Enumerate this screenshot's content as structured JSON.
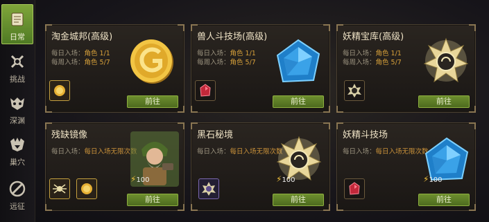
{
  "sidebar": {
    "items": [
      {
        "label": "日常",
        "icon": "scroll-icon",
        "active": true
      },
      {
        "label": "挑战",
        "icon": "crossed-swords-icon",
        "active": false
      },
      {
        "label": "深渊",
        "icon": "demon-mask-icon",
        "active": false
      },
      {
        "label": "巢穴",
        "icon": "dragon-lair-icon",
        "active": false
      },
      {
        "label": "远征",
        "icon": "expedition-icon",
        "active": false
      }
    ]
  },
  "cards": [
    {
      "title": "淘金城邦(高级)",
      "daily_label": "每日入场：",
      "daily_value": "角色 1/1",
      "weekly_label": "每周入场：",
      "weekly_value": "角色 5/7",
      "button": "前往",
      "art": "gold-coin-icon",
      "rewards": [
        "coin-icon"
      ]
    },
    {
      "title": "兽人斗技场(高级)",
      "daily_label": "每日入场：",
      "daily_value": "角色 1/1",
      "weekly_label": "每周入场：",
      "weekly_value": "角色 5/7",
      "button": "前往",
      "art": "blue-crystal-icon",
      "rewards": [
        "red-gem-icon"
      ]
    },
    {
      "title": "妖精宝库(高级)",
      "daily_label": "每日入场：",
      "daily_value": "角色 1/1",
      "weekly_label": "每周入场：",
      "weekly_value": "角色 5/7",
      "button": "前往",
      "art": "sun-emblem-icon",
      "rewards": [
        "emblem-icon"
      ]
    },
    {
      "title": "残缺镜像",
      "daily_label": "每日入场：",
      "daily_value": "每日入场无限次数",
      "button": "前往",
      "energy": "100",
      "art": "dwarf-hero-icon",
      "rewards": [
        "spider-emblem-icon",
        "coin-icon"
      ]
    },
    {
      "title": "黑石秘境",
      "daily_label": "每日入场：",
      "daily_value": "每日入场无限次数",
      "button": "前往",
      "energy": "100",
      "art": "sun-emblem-icon",
      "rewards": [
        "purple-emblem-icon"
      ]
    },
    {
      "title": "妖精斗技场",
      "daily_label": "每日入场：",
      "daily_value": "每日入场无限次数",
      "button": "前往",
      "energy": "100",
      "art": "blue-crystal-icon",
      "rewards": [
        "red-gem-icon"
      ]
    }
  ]
}
